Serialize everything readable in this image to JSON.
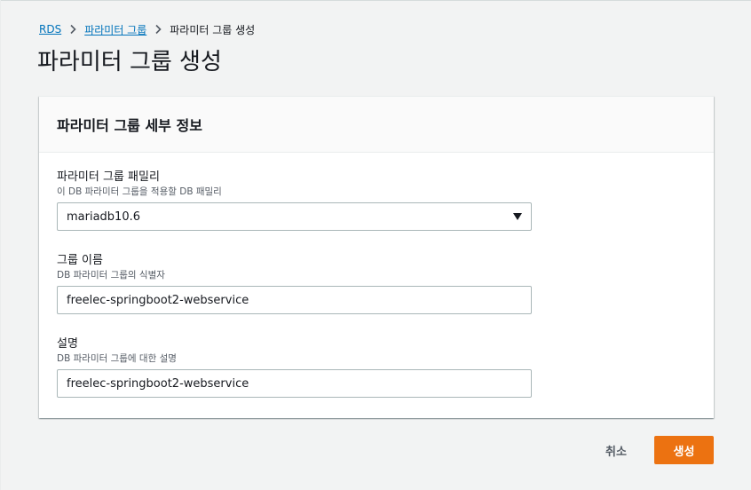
{
  "breadcrumb": {
    "items": [
      {
        "label": "RDS"
      },
      {
        "label": "파라미터 그룹"
      },
      {
        "label": "파라미터 그룹 생성"
      }
    ],
    "separator_icon": "chevron-right-icon"
  },
  "page": {
    "title": "파라미터 그룹 생성"
  },
  "panel": {
    "title": "파라미터 그룹 세부 정보",
    "fields": {
      "family": {
        "label": "파라미터 그룹 패밀리",
        "description": "이 DB 파라미터 그룹을 적용할 DB 패밀리",
        "value": "mariadb10.6",
        "icon": "caret-down-icon"
      },
      "name": {
        "label": "그룹 이름",
        "description": "DB 파라미터 그룹의 식별자",
        "value": "freelec-springboot2-webservice"
      },
      "description": {
        "label": "설명",
        "description": "DB 파라미터 그룹에 대한 설명",
        "value": "freelec-springboot2-webservice"
      }
    }
  },
  "actions": {
    "cancel_label": "취소",
    "create_label": "생성"
  },
  "colors": {
    "accent": "#ec7211",
    "link": "#0073bb",
    "background": "#f2f3f3"
  }
}
